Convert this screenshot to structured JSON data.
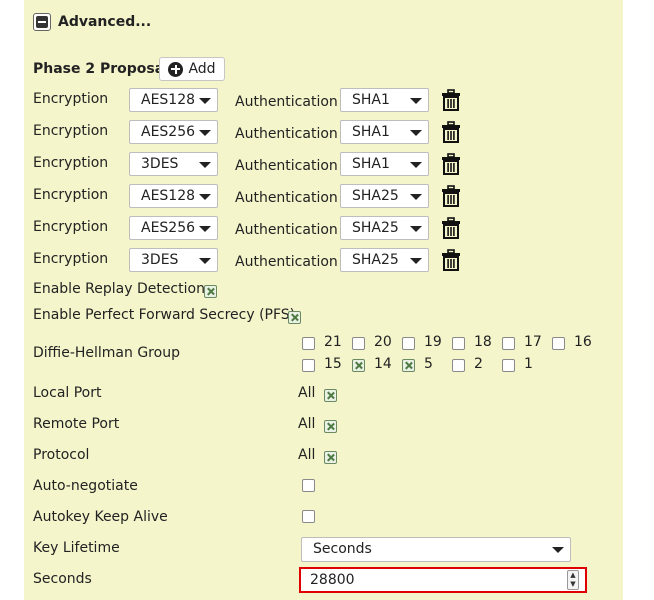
{
  "advanced": {
    "title": "Advanced..."
  },
  "phase2": {
    "title": "Phase 2 Proposal",
    "add_label": "Add",
    "enc_label": "Encryption",
    "auth_label": "Authentication",
    "proposals": [
      {
        "encryption": "AES128",
        "authentication": "SHA1"
      },
      {
        "encryption": "AES256",
        "authentication": "SHA1"
      },
      {
        "encryption": "3DES",
        "authentication": "SHA1"
      },
      {
        "encryption": "AES128",
        "authentication": "SHA25"
      },
      {
        "encryption": "AES256",
        "authentication": "SHA25"
      },
      {
        "encryption": "3DES",
        "authentication": "SHA25"
      }
    ]
  },
  "replay": {
    "label": "Enable Replay Detection",
    "checked": true
  },
  "pfs": {
    "label": "Enable Perfect Forward Secrecy (PFS)",
    "checked": true
  },
  "dh": {
    "label": "Diffie-Hellman Group",
    "groups": [
      {
        "value": "21",
        "checked": false
      },
      {
        "value": "20",
        "checked": false
      },
      {
        "value": "19",
        "checked": false
      },
      {
        "value": "18",
        "checked": false
      },
      {
        "value": "17",
        "checked": false
      },
      {
        "value": "16",
        "checked": false
      },
      {
        "value": "15",
        "checked": false
      },
      {
        "value": "14",
        "checked": true
      },
      {
        "value": "5",
        "checked": true
      },
      {
        "value": "2",
        "checked": false
      },
      {
        "value": "1",
        "checked": false
      }
    ]
  },
  "local_port": {
    "label": "Local Port",
    "all_label": "All",
    "checked": true
  },
  "remote_port": {
    "label": "Remote Port",
    "all_label": "All",
    "checked": true
  },
  "protocol": {
    "label": "Protocol",
    "all_label": "All",
    "checked": true
  },
  "auto_negotiate": {
    "label": "Auto-negotiate",
    "checked": false
  },
  "keep_alive": {
    "label": "Autokey Keep Alive",
    "checked": false
  },
  "key_lifetime": {
    "label": "Key Lifetime",
    "value": "Seconds"
  },
  "seconds": {
    "label": "Seconds",
    "value": "28800"
  }
}
